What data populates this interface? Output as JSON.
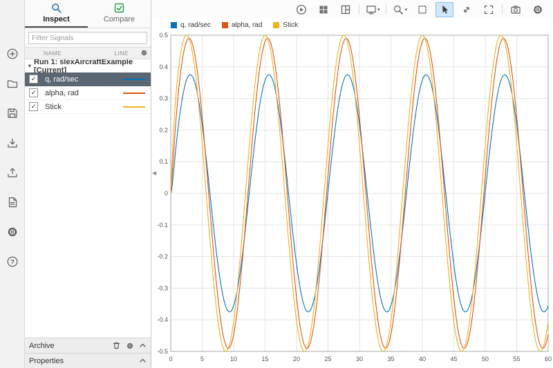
{
  "sidebar": {
    "icons": [
      "add",
      "open",
      "save",
      "import",
      "export",
      "create-report",
      "preferences",
      "help"
    ]
  },
  "toolbar": {
    "icons": [
      {
        "name": "run",
        "selected": false
      },
      {
        "name": "layout-grid",
        "selected": false
      },
      {
        "name": "layout-split",
        "selected": false
      },
      {
        "name": "display-options",
        "selected": false,
        "has_caret": true
      },
      {
        "name": "zoom-menu",
        "selected": false,
        "has_caret": true
      },
      {
        "name": "fit-to-view",
        "selected": false
      },
      {
        "name": "pointer",
        "selected": true
      },
      {
        "name": "expand",
        "selected": false
      },
      {
        "name": "fullscreen",
        "selected": false
      },
      {
        "name": "snapshot",
        "selected": false
      },
      {
        "name": "settings",
        "selected": false
      }
    ]
  },
  "panel": {
    "tabs": [
      {
        "label": "Inspect",
        "active": true
      },
      {
        "label": "Compare",
        "active": false
      }
    ],
    "filter_placeholder": "Filter Signals",
    "columns": [
      "NAME",
      "LINE"
    ],
    "run_label": "Run 1: slexAircraftExample [Current]",
    "signals": [
      {
        "name": "q, rad/sec",
        "color": "#0072BD",
        "checked": true,
        "selected": true
      },
      {
        "name": "alpha, rad",
        "color": "#D95319",
        "checked": true,
        "selected": false
      },
      {
        "name": "Stick",
        "color": "#EDB120",
        "checked": true,
        "selected": false
      }
    ],
    "archive_label": "Archive",
    "properties_label": "Properties"
  },
  "chart_data": {
    "type": "line",
    "title": "",
    "xlabel": "",
    "ylabel": "",
    "x_range": [
      0,
      60
    ],
    "y_range": [
      -0.5,
      0.5
    ],
    "x_ticks": [
      0,
      5,
      10,
      15,
      20,
      25,
      30,
      35,
      40,
      45,
      50,
      55,
      60
    ],
    "y_ticks": [
      -0.5,
      -0.4,
      -0.3,
      -0.2,
      -0.1,
      0,
      0.1,
      0.2,
      0.3,
      0.4,
      0.5
    ],
    "grid": true,
    "legend_position": "top-left",
    "series": [
      {
        "name": "q, rad/sec",
        "color": "#0072BD",
        "waveform": "sine",
        "amplitude": 0.375,
        "period": 12.5,
        "peak_x": 3.1,
        "start_y": 0
      },
      {
        "name": "alpha, rad",
        "color": "#D95319",
        "waveform": "sine",
        "amplitude": 0.49,
        "period": 12.5,
        "peak_x": 2.9,
        "start_y": 0
      },
      {
        "name": "Stick",
        "color": "#EDB120",
        "waveform": "sine",
        "amplitude": 0.5,
        "period": 12.5,
        "peak_x": 2.5,
        "start_y": 0
      }
    ]
  }
}
